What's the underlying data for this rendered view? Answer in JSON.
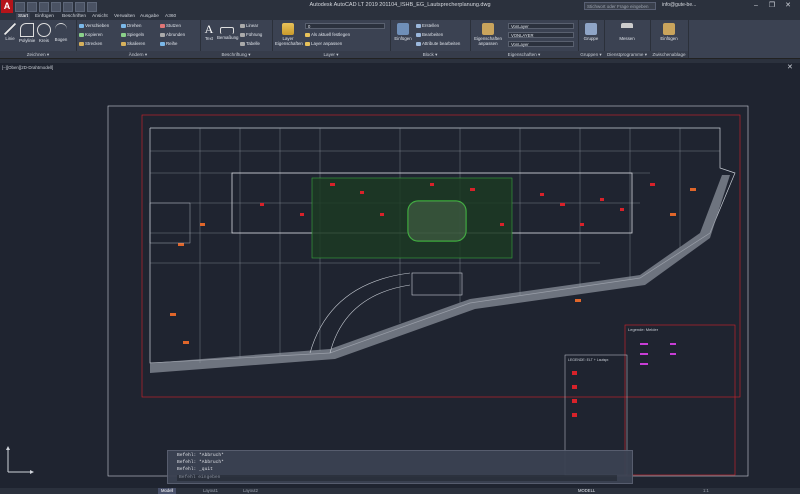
{
  "titlebar": {
    "logo": "A",
    "title": "Autodesk AutoCAD LT 2019    201104_ISHB_EG_Lautsprecherplanung.dwg",
    "search_placeholder": "Stichwort oder Frage eingeben",
    "user": "info@gute-be...",
    "minimize": "–",
    "maximize": "❐",
    "close": "✕"
  },
  "ribbon_tabs": [
    "Start",
    "Einfügen",
    "Beschriften",
    "Ansicht",
    "Verwalten",
    "Ausgabe",
    "A360"
  ],
  "ribbon": {
    "draw": {
      "line": "Linie",
      "polyline": "Polylinie",
      "circle": "Kreis",
      "arc": "Bogen",
      "footer": "Zeichnen ▾"
    },
    "modify": {
      "move": "Verschieben",
      "rotate": "Drehen",
      "trim": "Stutzen",
      "copy": "Kopieren",
      "mirror": "Spiegeln",
      "fillet": "Abrunden",
      "stretch": "Strecken",
      "scale": "Skalieren",
      "array": "Reihe",
      "footer": "Ändern ▾"
    },
    "annotation": {
      "text": "Text",
      "dimension": "Bemaßung",
      "linear": "Linear",
      "leader": "Führung",
      "table": "Tabelle",
      "footer": "Beschriftung ▾"
    },
    "layers": {
      "properties": "Layer\nEigenschaften",
      "layer_value": "0",
      "make_current": "Als aktuell festlegen",
      "match_layer": "Layer anpassen",
      "footer": "Layer ▾"
    },
    "block": {
      "insert": "Einfügen",
      "create": "Erstellen",
      "edit": "Bearbeiten",
      "edit_attr": "Attribute bearbeiten",
      "footer": "Block ▾"
    },
    "properties": {
      "match": "Eigenschaften\nanpassen",
      "color": "VonLayer",
      "linetype": "VONLAYER",
      "lineweight": "VonLayer",
      "footer": "Eigenschaften ▾"
    },
    "groups": {
      "group": "Gruppe",
      "footer": "Gruppen ▾"
    },
    "utilities": {
      "measure": "Messen",
      "footer": "Dienstprogramme ▾"
    },
    "clipboard": {
      "paste": "Einfügen",
      "footer": "Zwischenablage"
    }
  },
  "viewport": {
    "label": "[–][Oben][2D-Drahtmodell]",
    "close": "✕"
  },
  "drawing": {
    "legend_title": "Legende: Melder",
    "legend2_title": "LEGENDE: ELT + Lautspr."
  },
  "command": {
    "lines": [
      "Befehl: *Abbruch*",
      "Befehl: *Abbruch*",
      "Befehl: _quit"
    ],
    "input_placeholder": "Befehl eingeben"
  },
  "status": {
    "tabs": [
      "Modell",
      "Layout1",
      "Layout2"
    ],
    "model_button": "MODELL",
    "right": "1:1"
  },
  "colors": {
    "canvas": "#1f2430",
    "ribbon": "#3b4252",
    "red": "#d8222a",
    "green": "#3fbf3f",
    "orange": "#e0662a"
  }
}
